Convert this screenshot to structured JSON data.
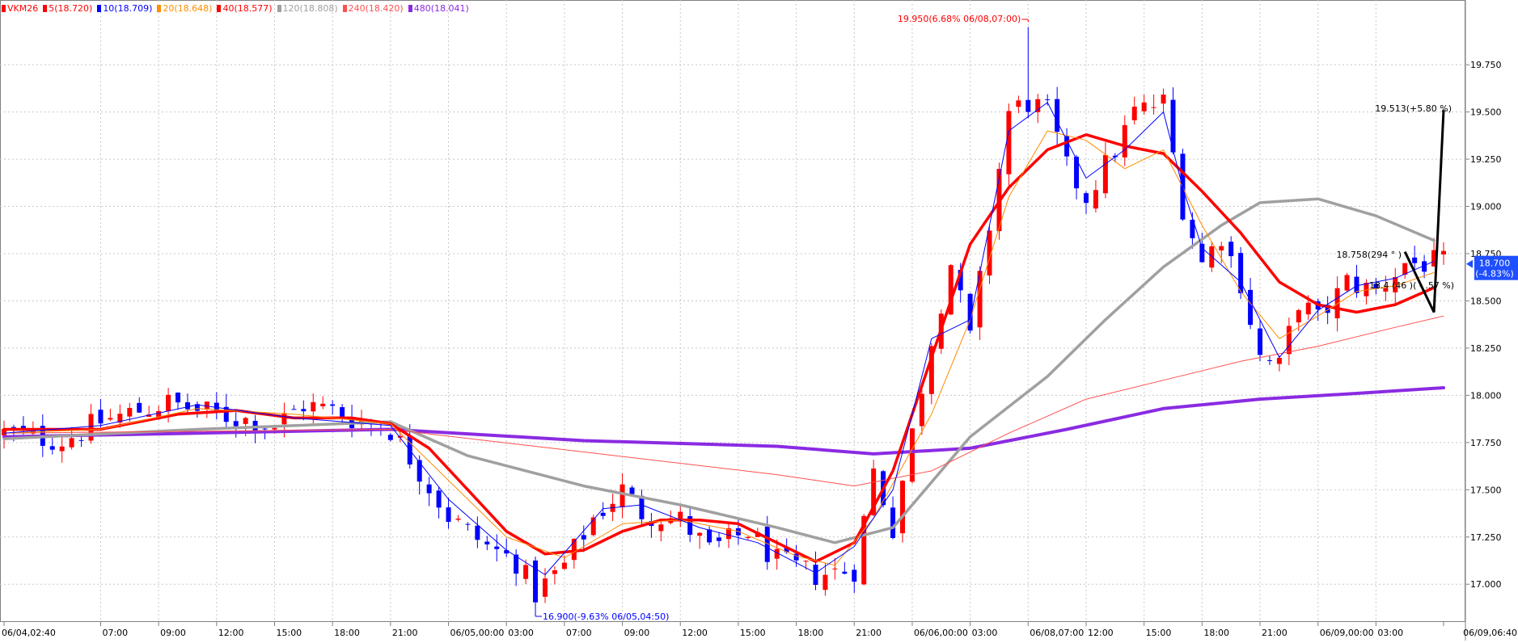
{
  "legend": [
    {
      "label": "VKM26",
      "color": "#ff0000"
    },
    {
      "label": "5(18.720)",
      "color": "#ff0000"
    },
    {
      "label": "10(18.709)",
      "color": "#0000ff"
    },
    {
      "label": "20(18.648)",
      "color": "#ff8c00"
    },
    {
      "label": "40(18.577)",
      "color": "#ff0000"
    },
    {
      "label": "120(18.808)",
      "color": "#a0a0a0"
    },
    {
      "label": "240(18.420)",
      "color": "#ff5050"
    },
    {
      "label": "480(18.041)",
      "color": "#8a2be2"
    }
  ],
  "annotations": {
    "high": "19.950(6.68% 06/08,07:00)",
    "low": "16.900(-9.63% 06/05,04:50)",
    "trend_top": "19.513(+5.80 %)",
    "trend_mid": "18.758(294 ° )",
    "trend_low": "18.4 (46 )( - .57 %)"
  },
  "current_price": {
    "value": "18.700",
    "change": "(-4.83%)",
    "bg": "#1f4fff"
  },
  "colors": {
    "up": "#ff0000",
    "down": "#0000ff",
    "grid": "#c8c8c8"
  },
  "chart_data": {
    "type": "candlestick",
    "symbol": "VKM26",
    "ylim": [
      16.8,
      20.05
    ],
    "y_ticks": [
      17.0,
      17.25,
      17.5,
      17.75,
      18.0,
      18.25,
      18.5,
      18.75,
      19.0,
      19.25,
      19.5,
      19.75
    ],
    "y_tick_labels": [
      "17.000",
      "17.250",
      "17.500",
      "17.750",
      "18.000",
      "18.250",
      "18.500",
      "18.750",
      "19.000",
      "19.250",
      "19.500",
      "19.750"
    ],
    "x_tick_labels": [
      "06/04,02:40",
      "07:00",
      "09:00",
      "12:00",
      "15:00",
      "18:00",
      "21:00",
      "06/05,00:00",
      "03:00",
      "07:00",
      "09:00",
      "12:00",
      "15:00",
      "18:00",
      "21:00",
      "06/06,00:00",
      "03:00",
      "06/08,07:00",
      "12:00",
      "15:00",
      "18:00",
      "21:00",
      "06/09,00:00",
      "03:00",
      "06/09,06:40"
    ],
    "x_tick_index": [
      0,
      10,
      16,
      22,
      28,
      34,
      40,
      46,
      52,
      58,
      64,
      70,
      76,
      82,
      88,
      94,
      100,
      106,
      112,
      118,
      124,
      130,
      136,
      142,
      149
    ],
    "close_path": [
      [
        0,
        17.8
      ],
      [
        6,
        17.76
      ],
      [
        10,
        17.86
      ],
      [
        14,
        17.92
      ],
      [
        17,
        17.96
      ],
      [
        20,
        17.92
      ],
      [
        24,
        17.88
      ],
      [
        28,
        17.84
      ],
      [
        31,
        17.95
      ],
      [
        34,
        17.92
      ],
      [
        36,
        17.88
      ],
      [
        40,
        17.82
      ],
      [
        43,
        17.6
      ],
      [
        46,
        17.36
      ],
      [
        50,
        17.2
      ],
      [
        53,
        17.12
      ],
      [
        55,
        16.95
      ],
      [
        58,
        17.1
      ],
      [
        61,
        17.35
      ],
      [
        64,
        17.5
      ],
      [
        66,
        17.38
      ],
      [
        70,
        17.34
      ],
      [
        73,
        17.18
      ],
      [
        77,
        17.28
      ],
      [
        80,
        17.12
      ],
      [
        84,
        17.05
      ],
      [
        88,
        17.08
      ],
      [
        90,
        17.6
      ],
      [
        92,
        17.3
      ],
      [
        94,
        17.8
      ],
      [
        96,
        18.3
      ],
      [
        98,
        18.7
      ],
      [
        100,
        18.3
      ],
      [
        102,
        18.9
      ],
      [
        104,
        19.5
      ],
      [
        106,
        19.55
      ],
      [
        108,
        19.5
      ],
      [
        110,
        19.2
      ],
      [
        112,
        19.05
      ],
      [
        115,
        19.3
      ],
      [
        117,
        19.5
      ],
      [
        120,
        19.55
      ],
      [
        122,
        19.0
      ],
      [
        124,
        18.7
      ],
      [
        126,
        18.85
      ],
      [
        128,
        18.6
      ],
      [
        130,
        18.2
      ],
      [
        132,
        18.15
      ],
      [
        134,
        18.5
      ],
      [
        136,
        18.4
      ],
      [
        139,
        18.6
      ],
      [
        142,
        18.55
      ],
      [
        145,
        18.7
      ],
      [
        148,
        18.7
      ]
    ],
    "candles_extra": {
      "high_peak": 19.95,
      "low_trough": 16.9
    },
    "series": [
      {
        "name": "480",
        "color": "#8a2be2",
        "width": 4,
        "points": [
          [
            0,
            17.78
          ],
          [
            20,
            17.8
          ],
          [
            40,
            17.82
          ],
          [
            60,
            17.76
          ],
          [
            80,
            17.73
          ],
          [
            90,
            17.69
          ],
          [
            100,
            17.72
          ],
          [
            110,
            17.82
          ],
          [
            120,
            17.93
          ],
          [
            130,
            17.98
          ],
          [
            140,
            18.01
          ],
          [
            149,
            18.04
          ]
        ]
      },
      {
        "name": "120",
        "color": "#a0a0a0",
        "width": 3.5,
        "points": [
          [
            0,
            17.77
          ],
          [
            20,
            17.82
          ],
          [
            40,
            17.86
          ],
          [
            48,
            17.68
          ],
          [
            60,
            17.52
          ],
          [
            70,
            17.42
          ],
          [
            80,
            17.3
          ],
          [
            86,
            17.22
          ],
          [
            92,
            17.3
          ],
          [
            100,
            17.78
          ],
          [
            108,
            18.1
          ],
          [
            114,
            18.4
          ],
          [
            120,
            18.68
          ],
          [
            126,
            18.9
          ],
          [
            130,
            19.02
          ],
          [
            136,
            19.04
          ],
          [
            142,
            18.95
          ],
          [
            148,
            18.82
          ]
        ]
      },
      {
        "name": "240",
        "color": "#ff5050",
        "width": 1,
        "points": [
          [
            0,
            17.8
          ],
          [
            40,
            17.82
          ],
          [
            60,
            17.7
          ],
          [
            80,
            17.58
          ],
          [
            88,
            17.52
          ],
          [
            96,
            17.6
          ],
          [
            104,
            17.8
          ],
          [
            112,
            17.98
          ],
          [
            120,
            18.08
          ],
          [
            128,
            18.18
          ],
          [
            136,
            18.26
          ],
          [
            144,
            18.36
          ],
          [
            149,
            18.42
          ]
        ]
      },
      {
        "name": "40",
        "color": "#ff0000",
        "width": 3.5,
        "points": [
          [
            0,
            17.82
          ],
          [
            10,
            17.82
          ],
          [
            18,
            17.9
          ],
          [
            24,
            17.92
          ],
          [
            30,
            17.88
          ],
          [
            36,
            17.88
          ],
          [
            40,
            17.85
          ],
          [
            44,
            17.72
          ],
          [
            48,
            17.5
          ],
          [
            52,
            17.28
          ],
          [
            56,
            17.16
          ],
          [
            60,
            17.18
          ],
          [
            64,
            17.28
          ],
          [
            68,
            17.34
          ],
          [
            72,
            17.34
          ],
          [
            76,
            17.32
          ],
          [
            80,
            17.22
          ],
          [
            84,
            17.12
          ],
          [
            88,
            17.22
          ],
          [
            92,
            17.6
          ],
          [
            96,
            18.2
          ],
          [
            100,
            18.8
          ],
          [
            104,
            19.1
          ],
          [
            108,
            19.3
          ],
          [
            112,
            19.38
          ],
          [
            116,
            19.32
          ],
          [
            120,
            19.28
          ],
          [
            124,
            19.08
          ],
          [
            128,
            18.86
          ],
          [
            132,
            18.6
          ],
          [
            136,
            18.48
          ],
          [
            140,
            18.44
          ],
          [
            144,
            18.48
          ],
          [
            148,
            18.57
          ]
        ]
      },
      {
        "name": "20",
        "color": "#ff8c00",
        "width": 1,
        "points": [
          [
            0,
            17.8
          ],
          [
            10,
            17.82
          ],
          [
            20,
            17.93
          ],
          [
            30,
            17.9
          ],
          [
            40,
            17.85
          ],
          [
            46,
            17.55
          ],
          [
            52,
            17.25
          ],
          [
            58,
            17.14
          ],
          [
            64,
            17.32
          ],
          [
            70,
            17.34
          ],
          [
            76,
            17.28
          ],
          [
            82,
            17.15
          ],
          [
            86,
            17.1
          ],
          [
            90,
            17.35
          ],
          [
            96,
            17.9
          ],
          [
            100,
            18.4
          ],
          [
            104,
            19.05
          ],
          [
            108,
            19.4
          ],
          [
            112,
            19.35
          ],
          [
            116,
            19.2
          ],
          [
            120,
            19.3
          ],
          [
            124,
            18.9
          ],
          [
            128,
            18.55
          ],
          [
            132,
            18.3
          ],
          [
            136,
            18.42
          ],
          [
            140,
            18.55
          ],
          [
            144,
            18.58
          ],
          [
            148,
            18.65
          ]
        ]
      },
      {
        "name": "10",
        "color": "#0000ff",
        "width": 1,
        "points": [
          [
            0,
            17.8
          ],
          [
            10,
            17.84
          ],
          [
            20,
            17.95
          ],
          [
            30,
            17.88
          ],
          [
            40,
            17.84
          ],
          [
            46,
            17.45
          ],
          [
            52,
            17.18
          ],
          [
            56,
            17.05
          ],
          [
            62,
            17.4
          ],
          [
            66,
            17.42
          ],
          [
            72,
            17.3
          ],
          [
            78,
            17.22
          ],
          [
            84,
            17.06
          ],
          [
            88,
            17.2
          ],
          [
            92,
            17.5
          ],
          [
            96,
            18.3
          ],
          [
            100,
            18.4
          ],
          [
            104,
            19.4
          ],
          [
            108,
            19.55
          ],
          [
            112,
            19.15
          ],
          [
            116,
            19.3
          ],
          [
            120,
            19.5
          ],
          [
            122,
            19.1
          ],
          [
            124,
            18.78
          ],
          [
            128,
            18.6
          ],
          [
            132,
            18.2
          ],
          [
            136,
            18.45
          ],
          [
            140,
            18.58
          ],
          [
            144,
            18.62
          ],
          [
            148,
            18.71
          ]
        ]
      }
    ],
    "trendlines": [
      {
        "color": "#000000",
        "width": 3,
        "points": [
          [
            145,
            18.76
          ],
          [
            148,
            18.44
          ],
          [
            149,
            19.51
          ]
        ]
      }
    ]
  }
}
